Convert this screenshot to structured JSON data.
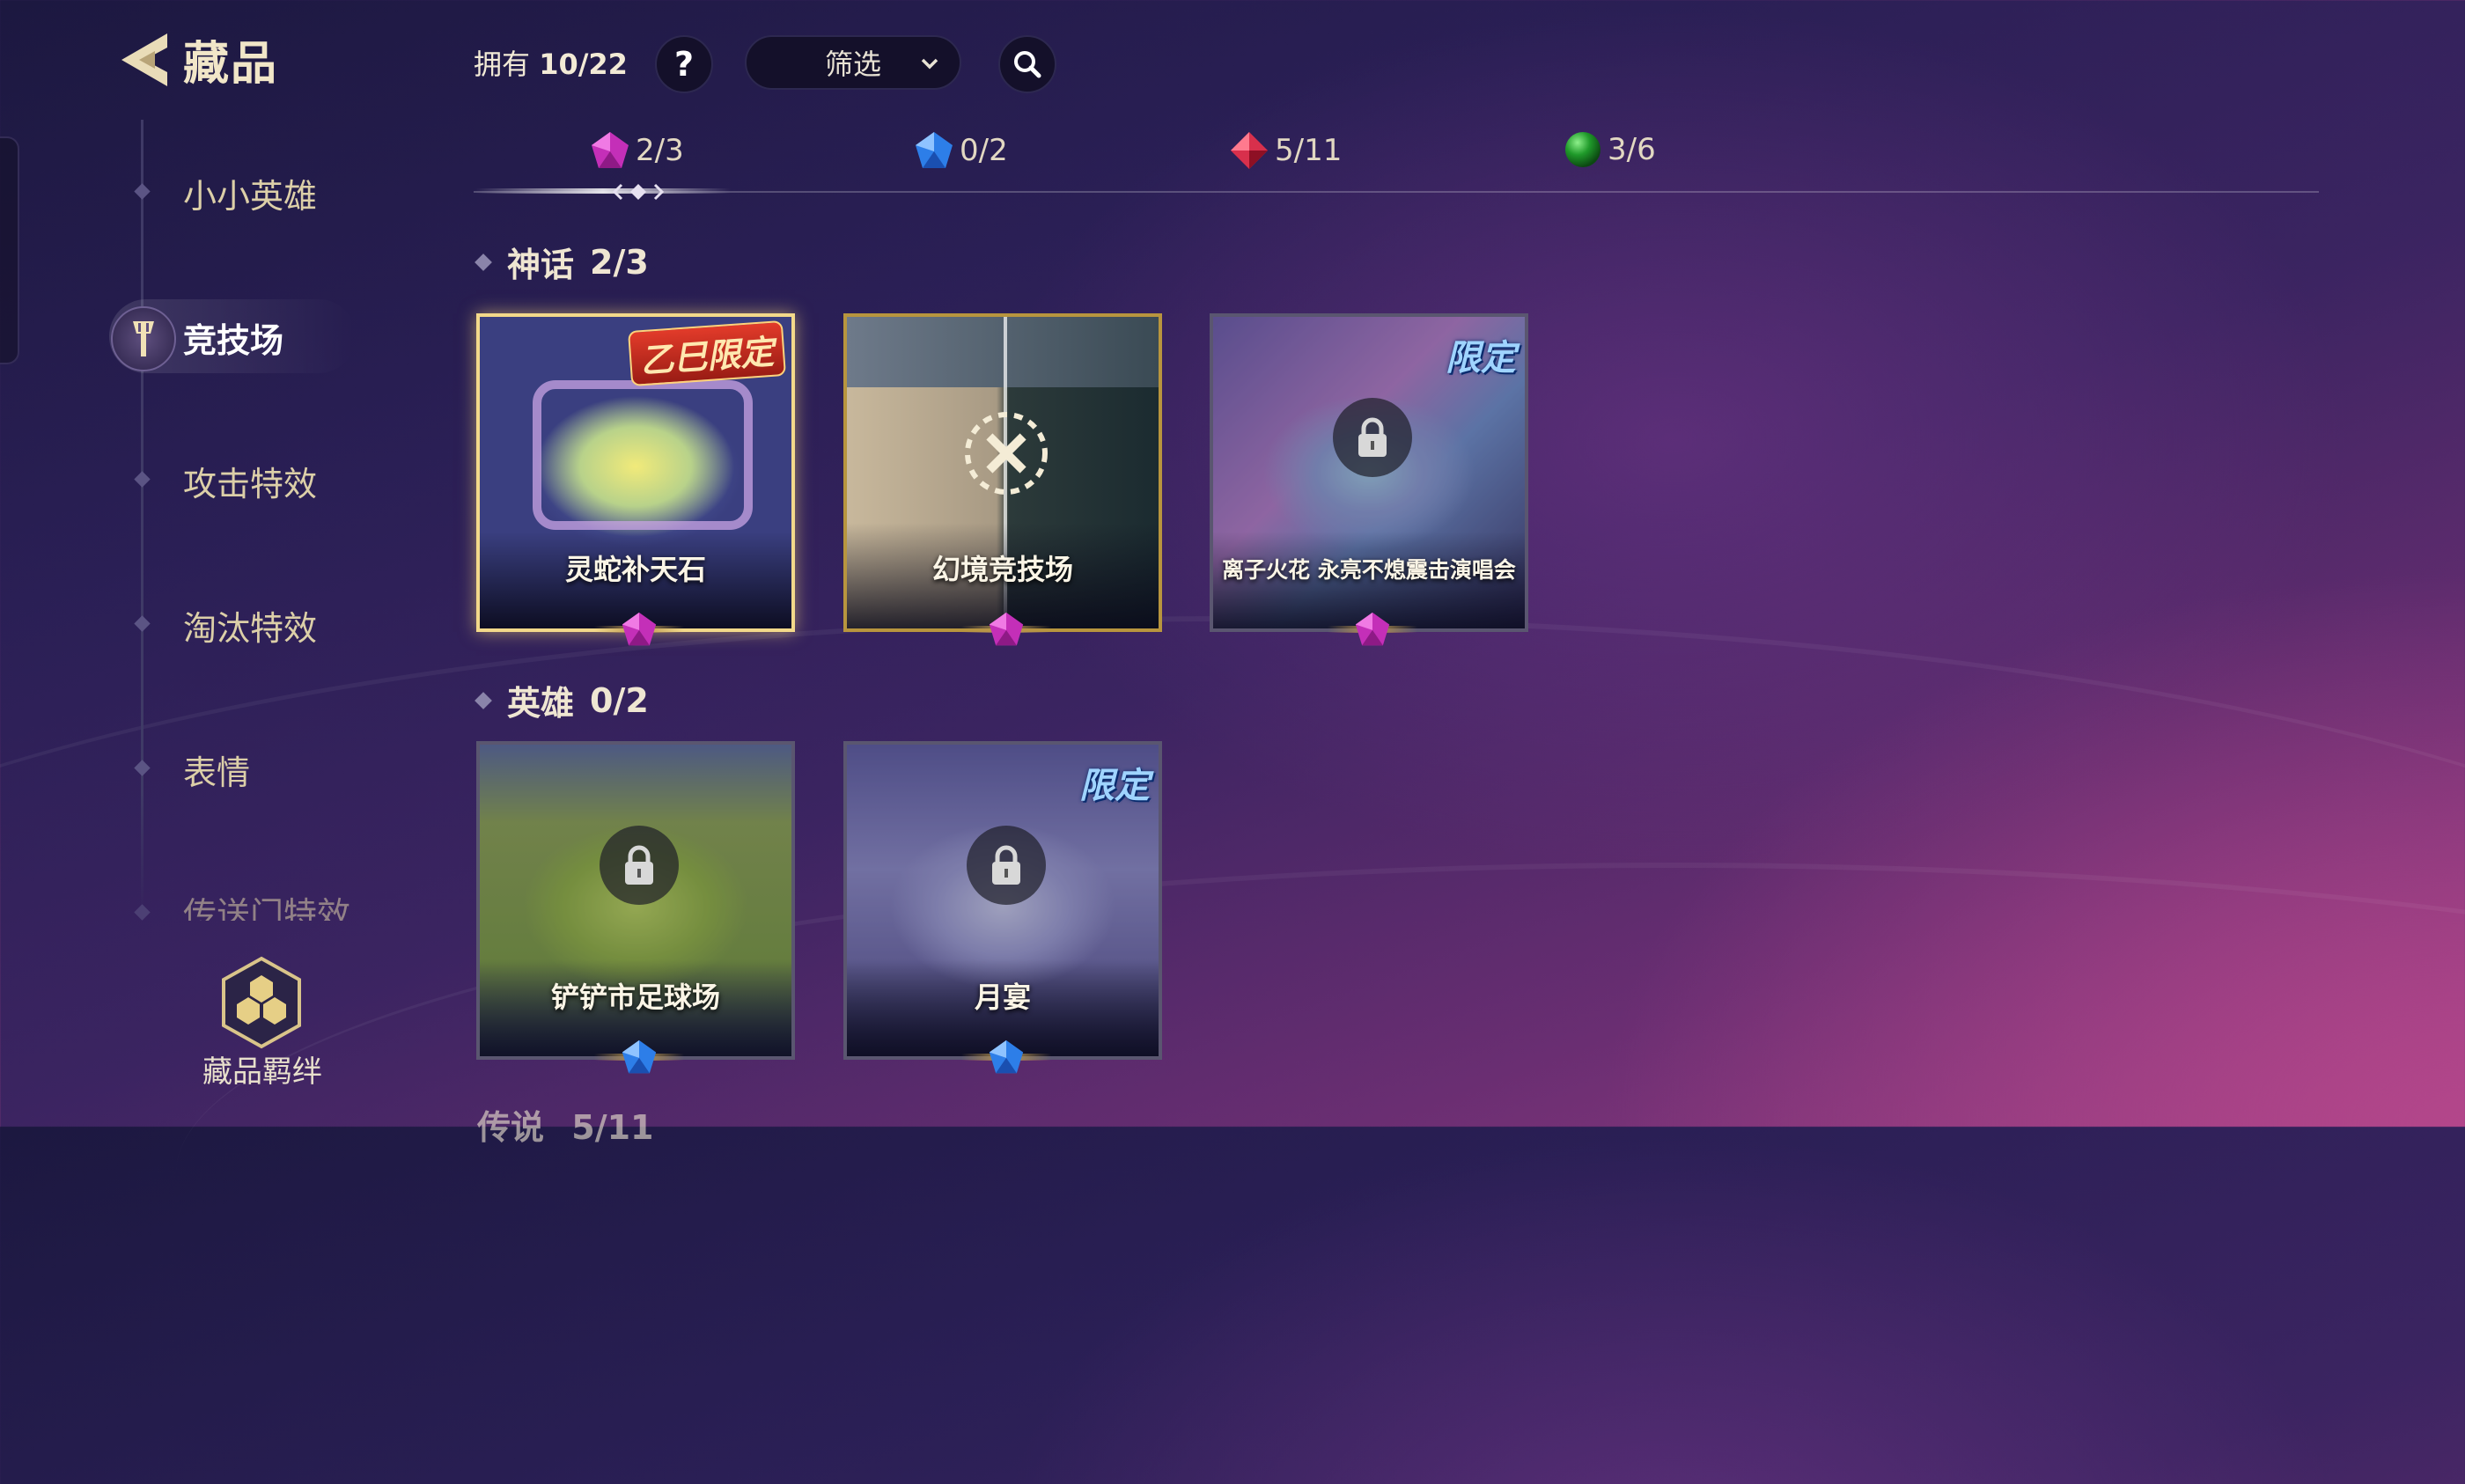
{
  "header": {
    "title": "藏品",
    "owned_label": "拥有",
    "owned_count": "10/22",
    "help_label": "?",
    "filter_label": "筛选"
  },
  "sidebar": {
    "items": [
      {
        "label": "小小英雄"
      },
      {
        "label": "竞技场"
      },
      {
        "label": "攻击特效"
      },
      {
        "label": "淘汰特效"
      },
      {
        "label": "表情"
      },
      {
        "label": "传送门特效"
      }
    ],
    "bond_label": "藏品羁绊"
  },
  "rarity_tabs": [
    {
      "count": "2/3",
      "gem": "purple-gem-icon",
      "color": "#c42fb8"
    },
    {
      "count": "0/2",
      "gem": "blue-gem-icon",
      "color": "#2d7ee8"
    },
    {
      "count": "5/11",
      "gem": "red-gem-icon",
      "color": "#d8304c"
    },
    {
      "count": "3/6",
      "gem": "green-orb-icon",
      "color": "#1f9a2a"
    }
  ],
  "sections": [
    {
      "title": "神话",
      "count": "2/3",
      "cards": [
        {
          "name": "灵蛇补天石",
          "badge": "乙巳限定",
          "locked": false,
          "equipped": true
        },
        {
          "name": "幻境竞技场",
          "locked": false,
          "equipped": false
        },
        {
          "name": "离子火花 永亮不熄震击演唱会",
          "badge": "限定",
          "locked": true
        }
      ]
    },
    {
      "title": "英雄",
      "count": "0/2",
      "cards": [
        {
          "name": "铲铲市足球场",
          "locked": true
        },
        {
          "name": "月宴",
          "badge": "限定",
          "locked": true
        }
      ]
    },
    {
      "title": "传说",
      "count": "5/11"
    }
  ]
}
